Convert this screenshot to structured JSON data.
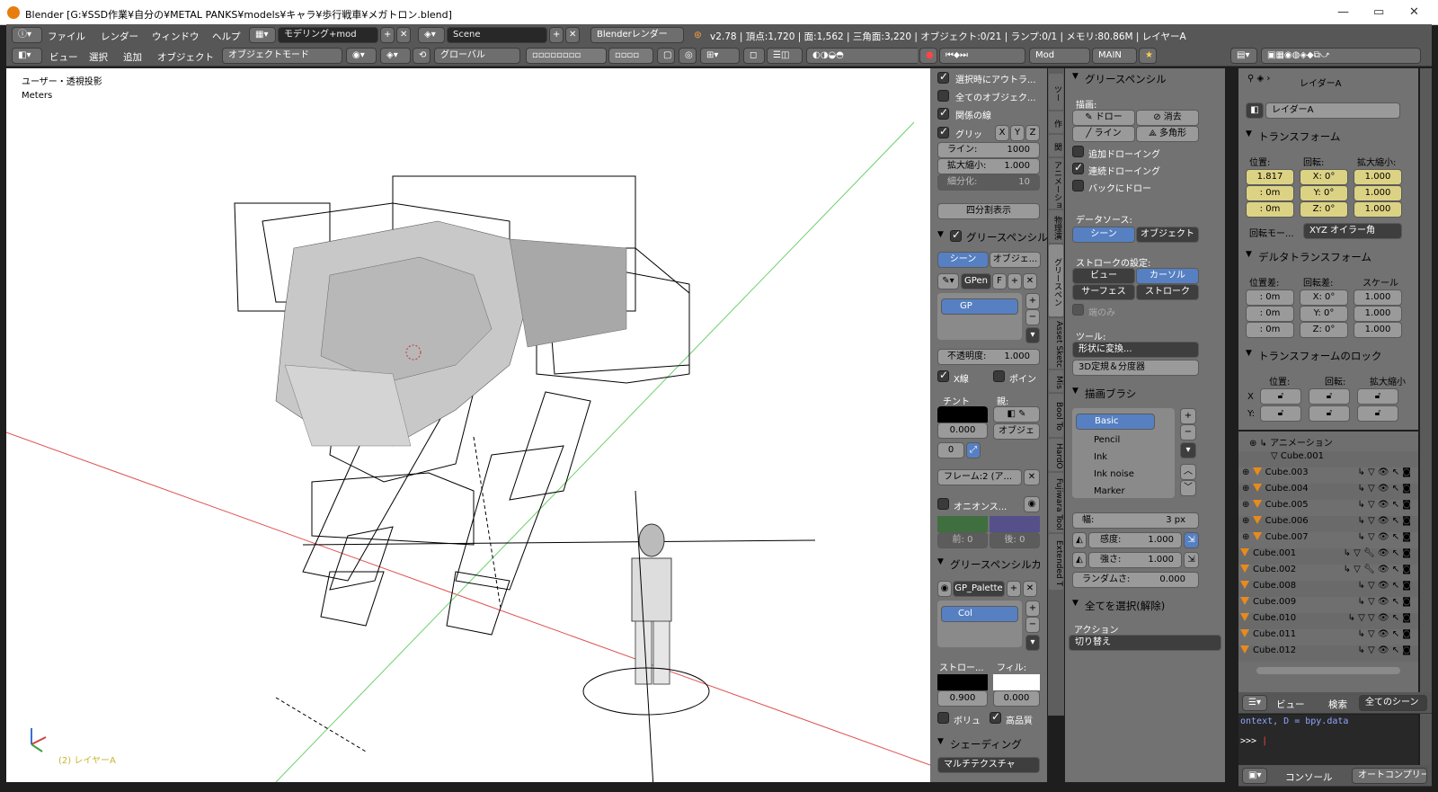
{
  "window": {
    "title": "Blender [G:¥SSD作業¥自分の¥METAL PANKS¥models¥キャラ¥歩行戦車¥メガトロン.blend]",
    "min": "—",
    "max": "▭",
    "close": "✕"
  },
  "info_bar": {
    "menus": [
      "ファイル",
      "レンダー",
      "ウィンドウ",
      "ヘルプ"
    ],
    "layout": "モデリング+mod",
    "scene": "Scene",
    "engine": "Blenderレンダー",
    "stats": "v2.78 | 頂点:1,720 | 面:1,562 | 三角面:3,220 | オブジェクト:0/21 | ランプ:0/1 | メモリ:80.86M | レイヤーA"
  },
  "view_header": {
    "menus": [
      "ビュー",
      "選択",
      "追加",
      "オブジェクト"
    ],
    "mode": "オブジェクトモード",
    "orientation": "グローバル",
    "mod_label": "Mod",
    "main_label": "MAIN"
  },
  "viewport": {
    "view_name": "ユーザー・透視投影",
    "units": "Meters",
    "status": "(2) レイヤーA"
  },
  "tool_shelf": {
    "outline_selected": "選択時にアウトラ...",
    "all_objects": "全てのオブジェク...",
    "relations": "関係の線",
    "grid": "グリッ",
    "x": "X",
    "y": "Y",
    "z": "Z",
    "lines_label": "ライン:",
    "lines_value": "1000",
    "scale_label": "拡大縮小:",
    "scale_value": "1.000",
    "subdiv_label": "細分化:",
    "subdiv_value": "10",
    "quad_view": "四分割表示",
    "gp_section": "グリースペンシル",
    "gp_scene": "シーン",
    "gp_object": "オブジェ...",
    "gp_name": "GPen",
    "gp_f": "F",
    "layer_name": "GP",
    "opacity_label": "不透明度:",
    "opacity_value": "1.000",
    "xray": "X線",
    "points": "ポイン",
    "tint_label": "チント",
    "parent_label": "親:",
    "tint_value": "0.000",
    "parent_type": "オブジェ",
    "frame_num": "0",
    "frame_label": "フレーム:2 (ア...",
    "onion_label": "オニオンス...",
    "before_label": "前: 0",
    "after_label": "後: 0",
    "palette_section": "グリースペンシルカ",
    "palette_name": "GP_Palette",
    "color_name": "Col",
    "stroke_label": "ストロー...",
    "fill_label": "フィル:",
    "stroke_value": "0.900",
    "fill_value": "0.000",
    "volume_label": "ボリュ",
    "hq_label": "高品質",
    "shading_section": "シェーディング",
    "shading_mode": "マルチテクスチャ"
  },
  "tabs": [
    "ツー",
    "作",
    "関",
    "アニメーション",
    "物理演",
    "グリースペン",
    "Asset Sketc",
    "Mis",
    "Bool To",
    "HardO",
    "Fujiwara Tool",
    "Extended T"
  ],
  "gp_tools": {
    "section": "グリースペンシル",
    "draw_label": "描画:",
    "draw": "ドロー",
    "erase": "消去",
    "line": "ライン",
    "poly": "多角形",
    "additive": "追加ドローイング",
    "continuous": "連続ドローイング",
    "back": "バックにドロー",
    "source_label": "データソース:",
    "source_scene": "シーン",
    "source_object": "オブジェクト",
    "stroke_label": "ストロークの設定:",
    "view": "ビュー",
    "cursor": "カーソル",
    "surface": "サーフェス",
    "stroke": "ストローク",
    "ends_only": "端のみ",
    "tools_label": "ツール:",
    "convert": "形状に変換...",
    "ruler": "3D定規＆分度器",
    "brushes_section": "描画ブラシ",
    "brushes": [
      "Basic",
      "Pencil",
      "Ink",
      "Ink noise",
      "Marker"
    ],
    "width_label": "幅:",
    "width_value": "3 px",
    "sens_label": "感度:",
    "sens_value": "1.000",
    "strength_label": "強さ:",
    "strength_value": "1.000",
    "random_label": "ランダムさ:",
    "random_value": "0.000",
    "select_all_section": "全てを選択(解除)",
    "action_label": "アクション",
    "action_value": "切り替え"
  },
  "properties": {
    "breadcrumb_obj": "レイダーA",
    "object_name": "レイダーA",
    "transform_section": "トランスフォーム",
    "loc_label": "位置:",
    "rot_label": "回転:",
    "scale_label": "拡大縮小:",
    "loc": [
      "1.817",
      ": 0m",
      ": 0m"
    ],
    "rot": [
      "X: 0°",
      "Y: 0°",
      "Z: 0°"
    ],
    "scale": [
      "1.000",
      "1.000",
      "1.000"
    ],
    "rot_mode_label": "回転モー...",
    "rot_mode_value": "XYZ オイラー角",
    "delta_section": "デルタトランスフォーム",
    "dloc_label": "位置差:",
    "drot_label": "回転差:",
    "dscale_label": "スケール",
    "dloc": [
      ": 0m",
      ": 0m",
      ": 0m"
    ],
    "drot": [
      "X: 0°",
      "Y: 0°",
      "Z: 0°"
    ],
    "dscale": [
      "1.000",
      "1.000",
      "1.000"
    ],
    "lock_section": "トランスフォームのロック",
    "lock_loc": "位置:",
    "lock_rot": "回転:",
    "lock_scale": "拡大縮小",
    "lock_x": "X",
    "lock_y": "Y:"
  },
  "outliner": {
    "items": [
      "アニメーション",
      "Cube.001",
      "Cube.003",
      "Cube.004",
      "Cube.005",
      "Cube.006",
      "Cube.007",
      "Cube.001",
      "Cube.002",
      "Cube.008",
      "Cube.009",
      "Cube.010",
      "Cube.011",
      "Cube.012"
    ],
    "footer_view": "ビュー",
    "footer_search": "検索",
    "footer_scenes": "全てのシーン"
  },
  "console": {
    "line1": "ontext, D = bpy.data",
    "prompt": ">>> ",
    "footer_console": "コンソール",
    "footer_autocomplete": "オートコンプリー"
  },
  "colors": {
    "accent_blue": "#5680c2",
    "panel_grey": "#727272",
    "header_grey": "#575757",
    "viewport_bg": "#ffffff",
    "outliner_orange": "#e88a1c"
  }
}
